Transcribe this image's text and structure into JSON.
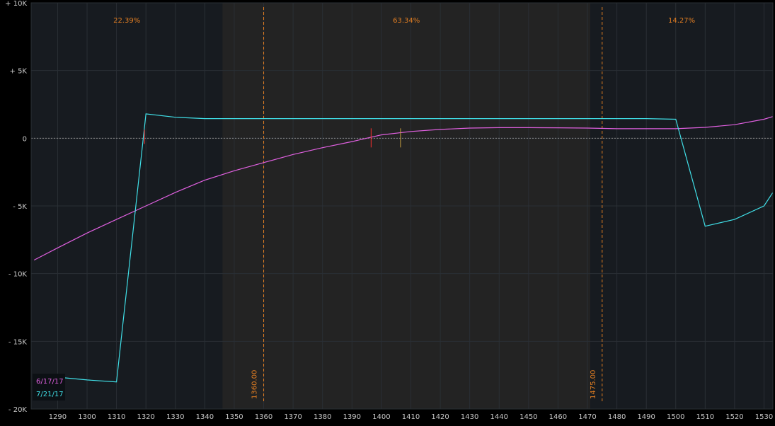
{
  "chart_data": {
    "type": "line",
    "title": "",
    "xlabel": "",
    "ylabel": "",
    "xlim": [
      1281,
      1533
    ],
    "ylim": [
      -20000,
      10000
    ],
    "x_ticks": [
      1290,
      1300,
      1310,
      1320,
      1330,
      1340,
      1350,
      1360,
      1370,
      1380,
      1390,
      1400,
      1410,
      1420,
      1430,
      1440,
      1450,
      1460,
      1470,
      1480,
      1490,
      1500,
      1510,
      1520,
      1530
    ],
    "y_ticks": [
      {
        "value": 10000,
        "label": "+ 10K"
      },
      {
        "value": 5000,
        "label": "+ 5K"
      },
      {
        "value": 0,
        "label": "0"
      },
      {
        "value": -5000,
        "label": "- 5K"
      },
      {
        "value": -10000,
        "label": "- 10K"
      },
      {
        "value": -15000,
        "label": "- 15K"
      },
      {
        "value": -20000,
        "label": "- 20K"
      }
    ],
    "grid": true,
    "regions": [
      {
        "from": 1281,
        "to": 1346,
        "label": "22.39%",
        "shade": "#171b20"
      },
      {
        "from": 1346,
        "to": 1471,
        "label": "63.34%",
        "shade": "#232323"
      },
      {
        "from": 1471,
        "to": 1533,
        "label": "14.27%",
        "shade": "#171b20"
      }
    ],
    "vertical_lines": [
      {
        "x": 1360,
        "label": "1360.00"
      },
      {
        "x": 1475,
        "label": "1475.00"
      }
    ],
    "markers": [
      {
        "x": 1396.5,
        "color": "#ff3030"
      },
      {
        "x": 1406.5,
        "color": "#c8a040"
      }
    ],
    "series": [
      {
        "name": "6/17/17",
        "color": "#e060e0",
        "x": [
          1282,
          1290,
          1300,
          1310,
          1320,
          1330,
          1340,
          1350,
          1360,
          1370,
          1380,
          1390,
          1400,
          1410,
          1420,
          1430,
          1440,
          1450,
          1460,
          1470,
          1480,
          1490,
          1500,
          1510,
          1520,
          1530,
          1533
        ],
        "y": [
          -9000,
          -8100,
          -7000,
          -6000,
          -5000,
          -4000,
          -3100,
          -2400,
          -1800,
          -1200,
          -700,
          -250,
          250,
          500,
          650,
          750,
          780,
          780,
          770,
          750,
          700,
          700,
          700,
          800,
          1000,
          1400,
          1600
        ]
      },
      {
        "name": "7/21/17",
        "color": "#40e0e8",
        "x": [
          1282,
          1290,
          1300,
          1310,
          1320,
          1330,
          1340,
          1350,
          1360,
          1380,
          1400,
          1420,
          1440,
          1460,
          1475,
          1490,
          1500,
          1510,
          1520,
          1530,
          1533
        ],
        "y": [
          -17500,
          -17650,
          -17850,
          -18000,
          1800,
          1550,
          1450,
          1450,
          1450,
          1450,
          1450,
          1450,
          1450,
          1450,
          1450,
          1450,
          1400,
          -6500,
          -6000,
          -5000,
          -4000
        ]
      }
    ]
  }
}
